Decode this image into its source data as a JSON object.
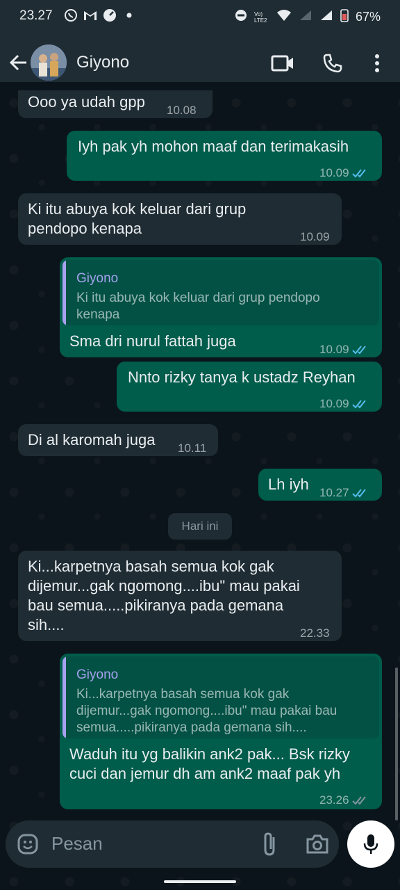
{
  "status_bar": {
    "time": "23.27",
    "battery": "67%",
    "network_label": "Vo) LTE2"
  },
  "header": {
    "contact_name": "Giyono"
  },
  "messages": [
    {
      "dir": "in",
      "text": "Ooo ya udah gpp",
      "time": "10.08"
    },
    {
      "dir": "out",
      "text": "Iyh pak yh mohon maaf dan terimakasih",
      "time": "10.09"
    },
    {
      "dir": "in",
      "lines": [
        "Ki itu abuya kok keluar dari grup",
        "pendopo kenapa"
      ],
      "time": "10.09"
    },
    {
      "dir": "out",
      "quote_author": "Giyono",
      "quote_lines": [
        "Ki itu abuya kok keluar dari grup pendopo",
        "kenapa"
      ],
      "text": "Sma dri nurul fattah juga",
      "time": "10.09"
    },
    {
      "dir": "out",
      "text": "Nnto rizky tanya k ustadz Reyhan",
      "time": "10.09"
    },
    {
      "dir": "in",
      "text": "Di al karomah juga",
      "time": "10.11"
    },
    {
      "dir": "out",
      "text": "Lh iyh",
      "time": "10.27"
    },
    {
      "dir": "in",
      "lines": [
        "Ki...karpetnya basah semua kok gak",
        "dijemur...gak ngomong....ibu\" mau pakai",
        "bau semua.....pikiranya pada gemana",
        "sih...."
      ],
      "time": "22.33"
    },
    {
      "dir": "out",
      "quote_author": "Giyono",
      "quote_lines": [
        "Ki...karpetnya basah semua kok gak",
        "dijemur...gak ngomong....ibu\" mau pakai bau",
        "semua.....pikiranya pada gemana sih...."
      ],
      "lines": [
        "Waduh itu yg balikin ank2 pak... Bsk rizky",
        "cuci dan jemur dh am ank2 maaf pak yh"
      ],
      "time": "23.26"
    }
  ],
  "date_separator": "Hari ini",
  "input": {
    "placeholder": "Pesan"
  },
  "colors": {
    "incoming": "#1f2c34",
    "outgoing": "#005c4b",
    "read_tick": "#53bdeb",
    "sent_tick": "#8696a0",
    "quote_author": "#a5a2f0"
  },
  "icons": [
    "back-arrow-icon",
    "video-call-icon",
    "phone-icon",
    "more-vert-icon",
    "emoji-icon",
    "attach-icon",
    "camera-icon",
    "mic-icon"
  ]
}
